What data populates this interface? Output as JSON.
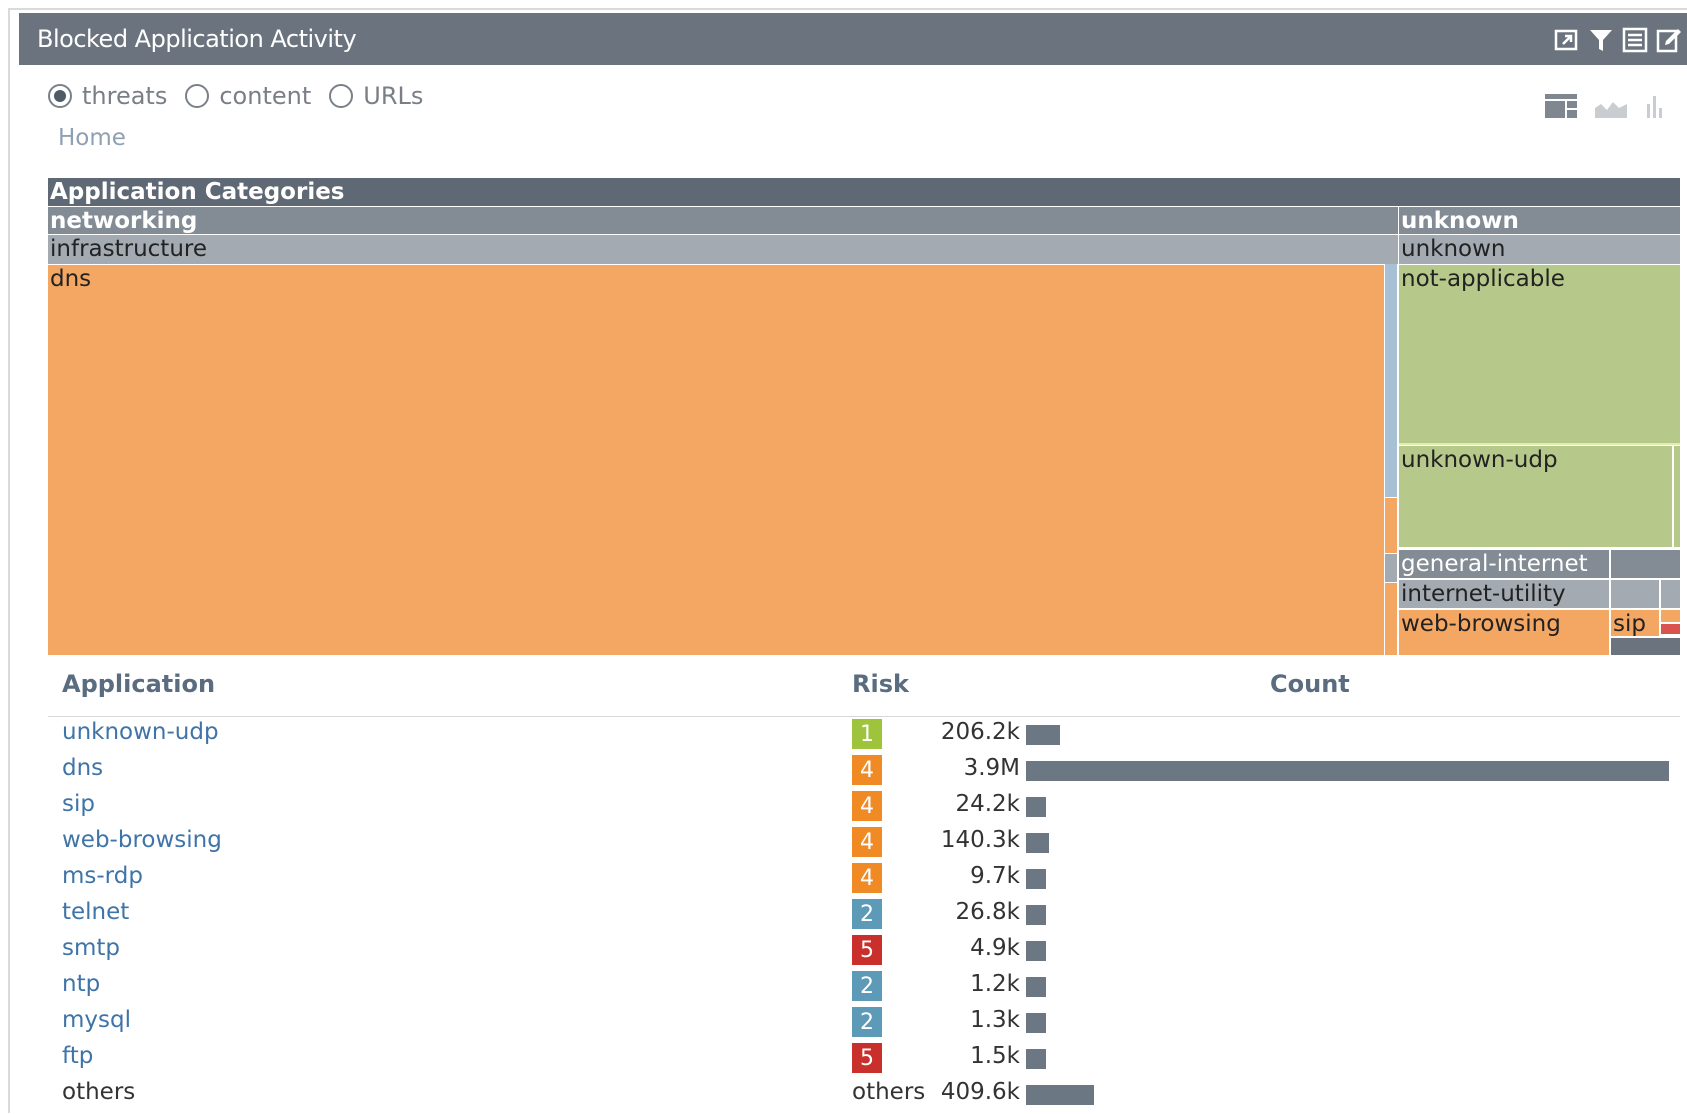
{
  "window": {
    "title": "Blocked Application Activity",
    "icons": [
      "pop-out-icon",
      "filter-icon",
      "list-icon",
      "edit-icon"
    ]
  },
  "radios": [
    {
      "label": "threats",
      "checked": true
    },
    {
      "label": "content",
      "checked": false
    },
    {
      "label": "URLs",
      "checked": false
    }
  ],
  "chart_type_icons": [
    "treemap-icon",
    "area-chart-icon",
    "bar-chart-icon"
  ],
  "breadcrumb": {
    "home": "Home"
  },
  "treemap": {
    "root": "Application Categories",
    "cells": {
      "networking": "networking",
      "infrastructure": "infrastructure",
      "dns": "dns",
      "unknown_cat": "unknown",
      "unknown_sub": "unknown",
      "not_applicable": "not-applicable",
      "unknown_udp": "unknown-udp",
      "general_internet": "general-internet",
      "internet_utility": "internet-utility",
      "web_browsing": "web-browsing",
      "sip": "sip"
    },
    "colors": {
      "header_dark": "#5f6975",
      "header_mid": "#838b95",
      "header_light": "#a3aab2",
      "orange": "#f4a663",
      "green": "#b6c98a",
      "blue": "#a7c0d4",
      "red": "#d9534f"
    }
  },
  "table": {
    "headers": {
      "application": "Application",
      "risk": "Risk",
      "count": "Count"
    },
    "rows": [
      {
        "app": "unknown-udp",
        "risk": "1",
        "risk_color": "#9dc43a",
        "count": "206.2k",
        "value": 206200
      },
      {
        "app": "dns",
        "risk": "4",
        "risk_color": "#f08a24",
        "count": "3.9M",
        "value": 3900000
      },
      {
        "app": "sip",
        "risk": "4",
        "risk_color": "#f08a24",
        "count": "24.2k",
        "value": 24200
      },
      {
        "app": "web-browsing",
        "risk": "4",
        "risk_color": "#f08a24",
        "count": "140.3k",
        "value": 140300
      },
      {
        "app": "ms-rdp",
        "risk": "4",
        "risk_color": "#f08a24",
        "count": "9.7k",
        "value": 9700
      },
      {
        "app": "telnet",
        "risk": "2",
        "risk_color": "#5c9ab8",
        "count": "26.8k",
        "value": 26800
      },
      {
        "app": "smtp",
        "risk": "5",
        "risk_color": "#c9302c",
        "count": "4.9k",
        "value": 4900
      },
      {
        "app": "ntp",
        "risk": "2",
        "risk_color": "#5c9ab8",
        "count": "1.2k",
        "value": 1200
      },
      {
        "app": "mysql",
        "risk": "2",
        "risk_color": "#5c9ab8",
        "count": "1.3k",
        "value": 1300
      },
      {
        "app": "ftp",
        "risk": "5",
        "risk_color": "#c9302c",
        "count": "1.5k",
        "value": 1500
      },
      {
        "app": "others",
        "risk": "others",
        "risk_color": "",
        "count": "409.6k",
        "value": 409600
      }
    ]
  }
}
